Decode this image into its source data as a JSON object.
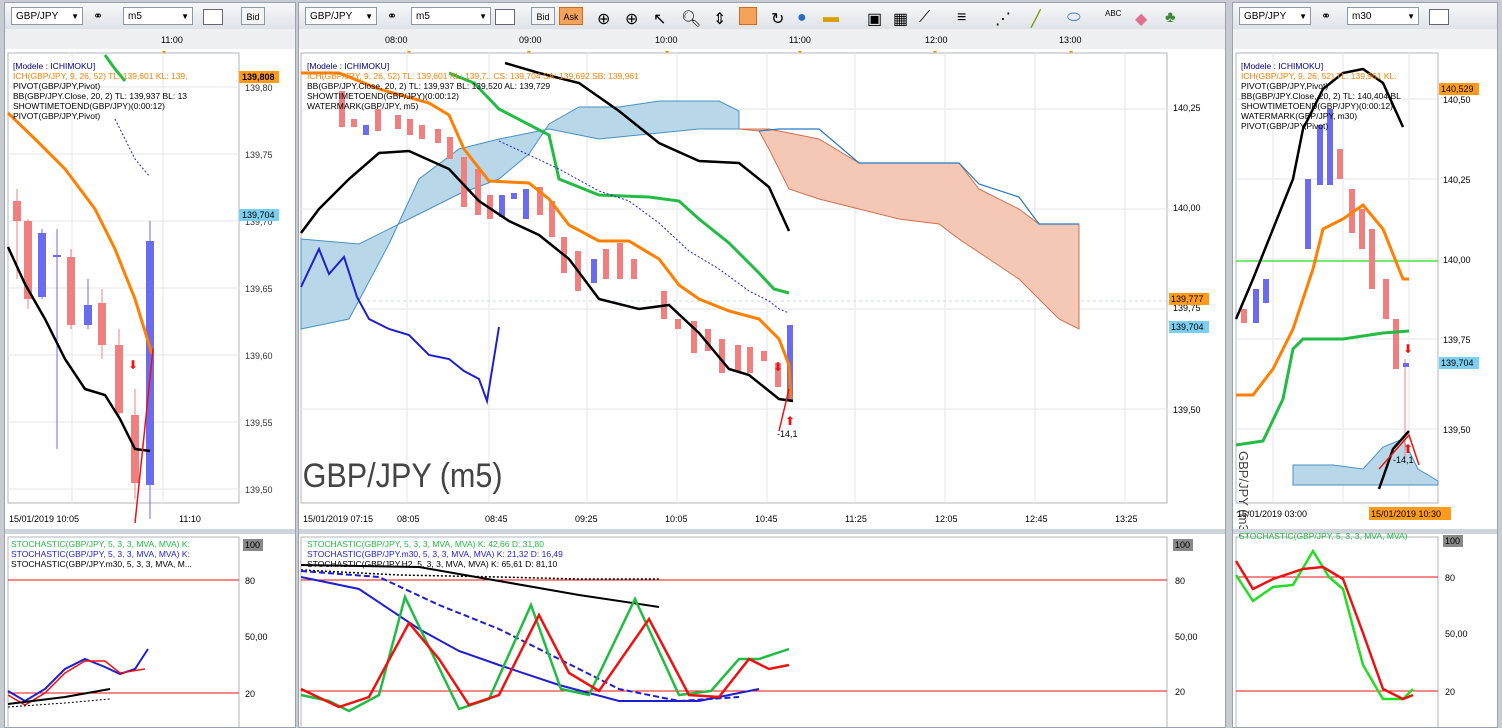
{
  "left": {
    "symbol": "GBP/JPY",
    "timeframe": "m5",
    "bid_label": "Bid",
    "time_top": "11:00",
    "info_lines": [
      "[Modele : ICHIMOKU]",
      "ICH(GBP/JPY, 9, 26, 52)  TL: 139,601  KL: 139,",
      "PIVOT(GBP/JPY,Pivot)",
      "BB(GBP/JPY.Close, 20, 2)  TL: 139,937  BL: 13",
      "SHOWTIMETOEND(GBP/JPY)(0:00:12)",
      "PIVOT(GBP/JPY,Pivot)"
    ],
    "price_ticks": [
      "139,80",
      "139,75",
      "139,70",
      "139,65",
      "139,60",
      "139,55",
      "139,50"
    ],
    "badge_top": "139,808",
    "badge_mid": "139,704",
    "x_labels": [
      "15/01/2019 10:05",
      "11:10"
    ],
    "stoch_lines": [
      "STOCHASTIC(GBP/JPY, 5, 3, 3, MVA, MVA)  K:",
      "STOCHASTIC(GBP/JPY, 5, 3, 3, MVA, MVA)  K:",
      "STOCHASTIC(GBP/JPY.m30, 5, 3, 3, MVA, M..."
    ],
    "stoch_ticks": [
      "100",
      "80",
      "50,00",
      "20"
    ]
  },
  "center": {
    "symbol": "GBP/JPY",
    "timeframe": "m5",
    "bid_label": "Bid",
    "ask_label": "Ask",
    "time_top": [
      "08:00",
      "09:00",
      "10:00",
      "11:00",
      "12:00",
      "13:00"
    ],
    "info_lines": [
      "[Modele : ICHIMOKU]",
      "ICH(GBP/JPY, 9, 26, 52)  TL: 139,601  KL: 139,7..  CS: 139,704  SA: 139,692  SB: 139,961",
      "BB(GBP/JPY.Close, 20, 2)  TL: 139,937  BL: 139,520  AL: 139,729",
      "SHOWTIMETOEND(GBP/JPY)(0:00:12)",
      "WATERMARK(GBP/JPY, m5)"
    ],
    "watermark": "GBP/JPY (m5)",
    "price_ticks": [
      "140,25",
      "140,00",
      "139,75",
      "139,50"
    ],
    "badge_orange": "139,777",
    "badge_blue": "139,704",
    "annotation": "-14,1",
    "x_labels": [
      "15/01/2019 07:15",
      "08:05",
      "08:45",
      "09:25",
      "10:05",
      "10:45",
      "11:25",
      "12:05",
      "12:45",
      "13:25"
    ],
    "stoch_lines": [
      "STOCHASTIC(GBP/JPY, 5, 3, 3, MVA, MVA)  K: 42,66  D: 31,80",
      "STOCHASTIC(GBP/JPY.m30, 5, 3, 3, MVA, MVA)  K: 21,32  D: 16,49",
      "STOCHASTIC(GBP/JPY.H2, 5, 3, 3, MVA, MVA)  K: 65,61  D: 81,10"
    ],
    "stoch_ticks": [
      "100",
      "80",
      "50,00",
      "20"
    ]
  },
  "right": {
    "symbol": "GBP/JPY",
    "timeframe": "m30",
    "info_lines": [
      "[Modele : ICHIMOKU]",
      "ICH(GBP/JPY, 9, 26, 52)  TL: 139,961  KL:",
      "PIVOT(GBP/JPY,Pivot)",
      "BB(GBP/JPY.Close, 20, 2)  TL: 140,404  BL",
      "SHOWTIMETOEND(GBP/JPY)(0:00:12)",
      "WATERMARK(GBP/JPY, m30)",
      "PIVOT(GBP/JPY,Pivot)"
    ],
    "price_ticks": [
      "140,50",
      "140,25",
      "140,00",
      "139,75",
      "139,50"
    ],
    "badge_top": "140,529",
    "badge_mid": "139,704",
    "annotation": "-14,1",
    "watermark": "GBP/JPY (m30)",
    "x_labels": [
      "15/01/2019 03:00",
      "15/01/2019 10:30"
    ],
    "stoch_lines": [
      "STOCHASTIC(GBP/JPY, 5, 3, 3, MVA, MVA)"
    ],
    "stoch_ticks": [
      "100",
      "80",
      "50,00",
      "20"
    ]
  },
  "colors": {
    "orange": "#ff7f00",
    "green": "#22bb44",
    "black": "#000000",
    "blue": "#1f1fd0",
    "red": "#ee1111",
    "cloud_blue": "#b8d8ea",
    "cloud_red": "#f4c8b4",
    "candle_red": "#f08080",
    "candle_blue": "#6b6bef"
  }
}
